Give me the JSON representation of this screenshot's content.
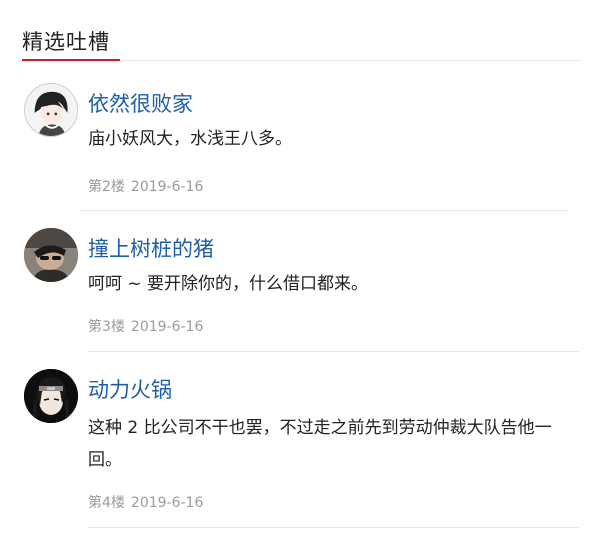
{
  "section": {
    "title": "精选吐槽"
  },
  "comments": [
    {
      "username": "依然很败家",
      "text": "庙小妖风大，水浅王八多。",
      "floor": "第2楼",
      "date": "2019-6-16",
      "avatar_icon": "user-avatar-anime-boy"
    },
    {
      "username": "撞上树桩的猪",
      "text": "呵呵 ~ 要开除你的，什么借口都来。",
      "floor": "第3楼",
      "date": "2019-6-16",
      "avatar_icon": "user-avatar-photo"
    },
    {
      "username": "动力火锅",
      "text": "这种 2 比公司不干也罢，不过走之前先到劳动仲裁大队告他一回。",
      "floor": "第4楼",
      "date": "2019-6-16",
      "avatar_icon": "user-avatar-anime-ninja"
    }
  ],
  "colors": {
    "accent": "#c8232c",
    "username": "#1f5fa8",
    "meta": "#9a9a9a"
  }
}
